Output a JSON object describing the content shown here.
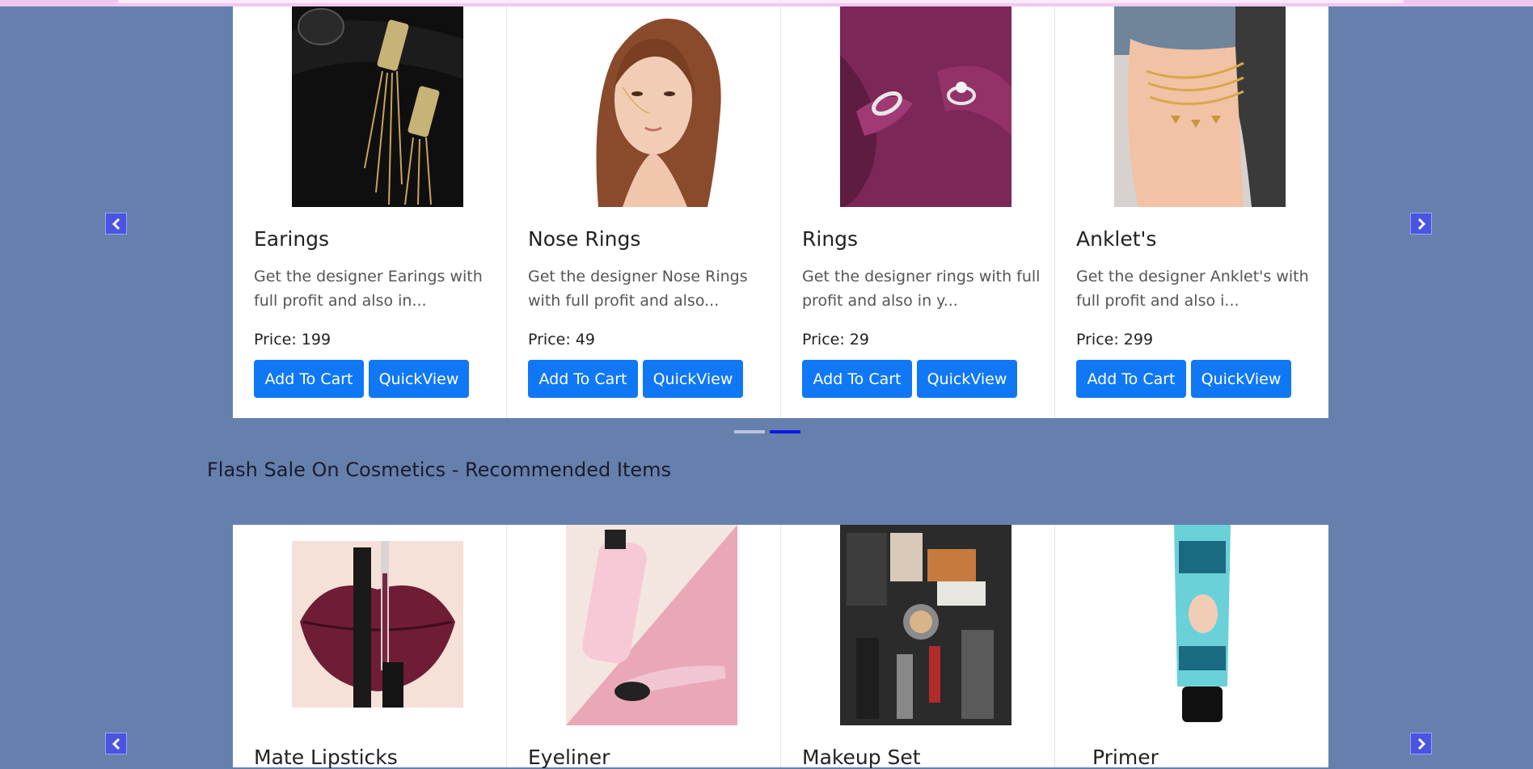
{
  "carousel1": {
    "cards": [
      {
        "title": "Earings",
        "desc": "Get the designer Earings with full profit and also in...",
        "price": "Price: 199",
        "cart": "Add To Cart",
        "quick": "QuickView",
        "img": "earrings-image"
      },
      {
        "title": "Nose Rings",
        "desc": "Get the designer Nose Rings with full profit and also...",
        "price": "Price: 49",
        "cart": "Add To Cart",
        "quick": "QuickView",
        "img": "nose-ring-model-image"
      },
      {
        "title": "Rings",
        "desc": "Get the designer rings with full profit and also in y...",
        "price": "Price: 29",
        "cart": "Add To Cart",
        "quick": "QuickView",
        "img": "rings-image"
      },
      {
        "title": "Anklet's",
        "desc": "Get the designer Anklet's with full profit and also i...",
        "price": "Price: 299",
        "cart": "Add To Cart",
        "quick": "QuickView",
        "img": "anklet-image"
      }
    ],
    "prev_icon": "chevron-left-icon",
    "next_icon": "chevron-right-icon",
    "active_indicator": 1
  },
  "section_title": "Flash Sale On Cosmetics - Recommended Items",
  "carousel2": {
    "cards": [
      {
        "title": "Mate Lipsticks",
        "img": "lipstick-image"
      },
      {
        "title": "Eyeliner",
        "img": "eyeliner-image"
      },
      {
        "title": "Makeup Set",
        "img": "makeup-set-image"
      },
      {
        "title": "Primer",
        "img": "primer-image"
      }
    ]
  },
  "colors": {
    "background": "#6680ad",
    "button": "#1178f5",
    "arrow": "#4a54e0",
    "indicator_active": "#0a18e8"
  }
}
